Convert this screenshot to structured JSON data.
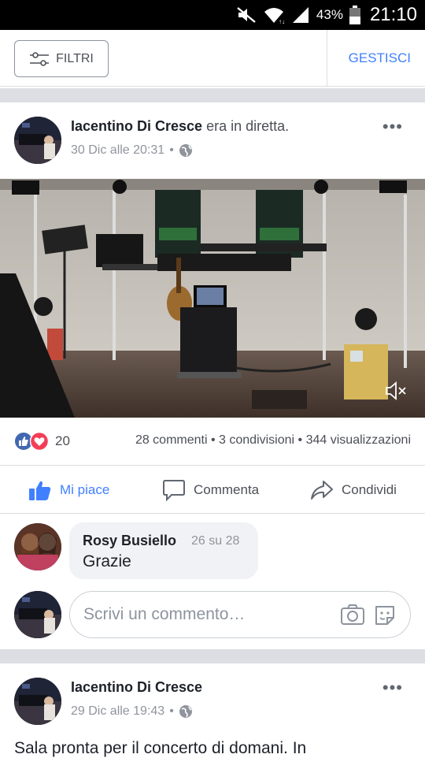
{
  "status_bar": {
    "battery_pct": "43%",
    "time": "21:10",
    "icons": [
      "mute-icon",
      "wifi-icon",
      "signal-icon",
      "battery-icon"
    ]
  },
  "filter_bar": {
    "filter_label": "FILTRI",
    "manage_label": "GESTISCI"
  },
  "posts": [
    {
      "author": "Iacentino Di Cresce",
      "verb": "era in diretta.",
      "date": "30 Dic alle 20:31",
      "reaction_count": "20",
      "comments": "28 commenti",
      "shares": "3 condivisioni",
      "views": "344 visualizzazioni",
      "actions": {
        "like": "Mi piace",
        "comment": "Commenta",
        "share": "Condividi"
      },
      "top_comment": {
        "name": "Rosy Busiello",
        "time": "26 su 28",
        "text": "Grazie"
      },
      "write_placeholder": "Scrivi un commento…"
    },
    {
      "author": "Iacentino Di Cresce",
      "date": "29 Dic alle 19:43",
      "text": "Sala pronta per il concerto di domani. In"
    }
  ],
  "colors": {
    "accent": "#4080ff",
    "like_blue": "#4267b2",
    "love_red": "#f33e58",
    "separator": "#dcdee3"
  }
}
